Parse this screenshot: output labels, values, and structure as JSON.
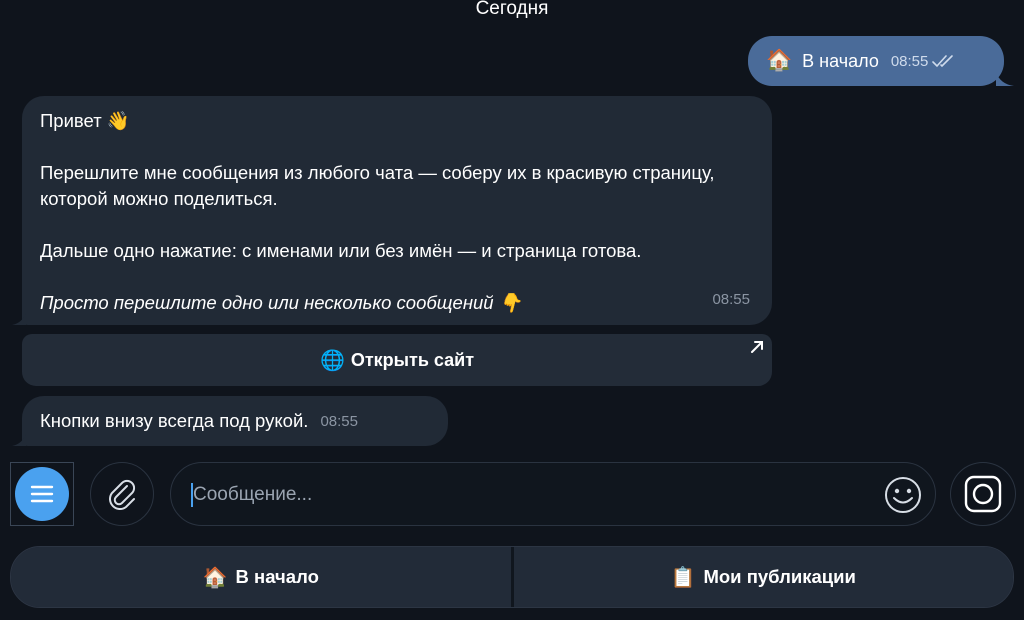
{
  "date_header": "Сегодня",
  "outgoing": {
    "emoji": "🏠",
    "text": "В начало",
    "time": "08:55"
  },
  "incoming_main": {
    "greeting": "Привет 👋",
    "line1": "Перешлите мне сообщения из любого чата — соберу их в красивую страницу, которой можно поделиться.",
    "line2": "Дальше одно нажатие: с именами или без имён — и страница готова.",
    "line3": "Просто перешлите одно или несколько сообщений 👇",
    "time": "08:55"
  },
  "inline_button": {
    "emoji": "🌐",
    "label": "Открыть сайт"
  },
  "incoming_small": {
    "text": "Кнопки внизу всегда под рукой.",
    "time": "08:55"
  },
  "composer": {
    "placeholder": "Сообщение..."
  },
  "keyboard": {
    "buttons": [
      {
        "emoji": "🏠",
        "label": "В начало"
      },
      {
        "emoji": "📋",
        "label": "Мои публикации"
      }
    ]
  },
  "colors": {
    "accent": "#4aa1ef",
    "outgoing_bubble": "#4a6b99",
    "incoming_bubble": "#212a36",
    "background": "#0f141c"
  },
  "icons": [
    "menu-icon",
    "paperclip-icon",
    "emoji-icon",
    "camera-icon",
    "double-check-icon",
    "open-external-icon"
  ]
}
